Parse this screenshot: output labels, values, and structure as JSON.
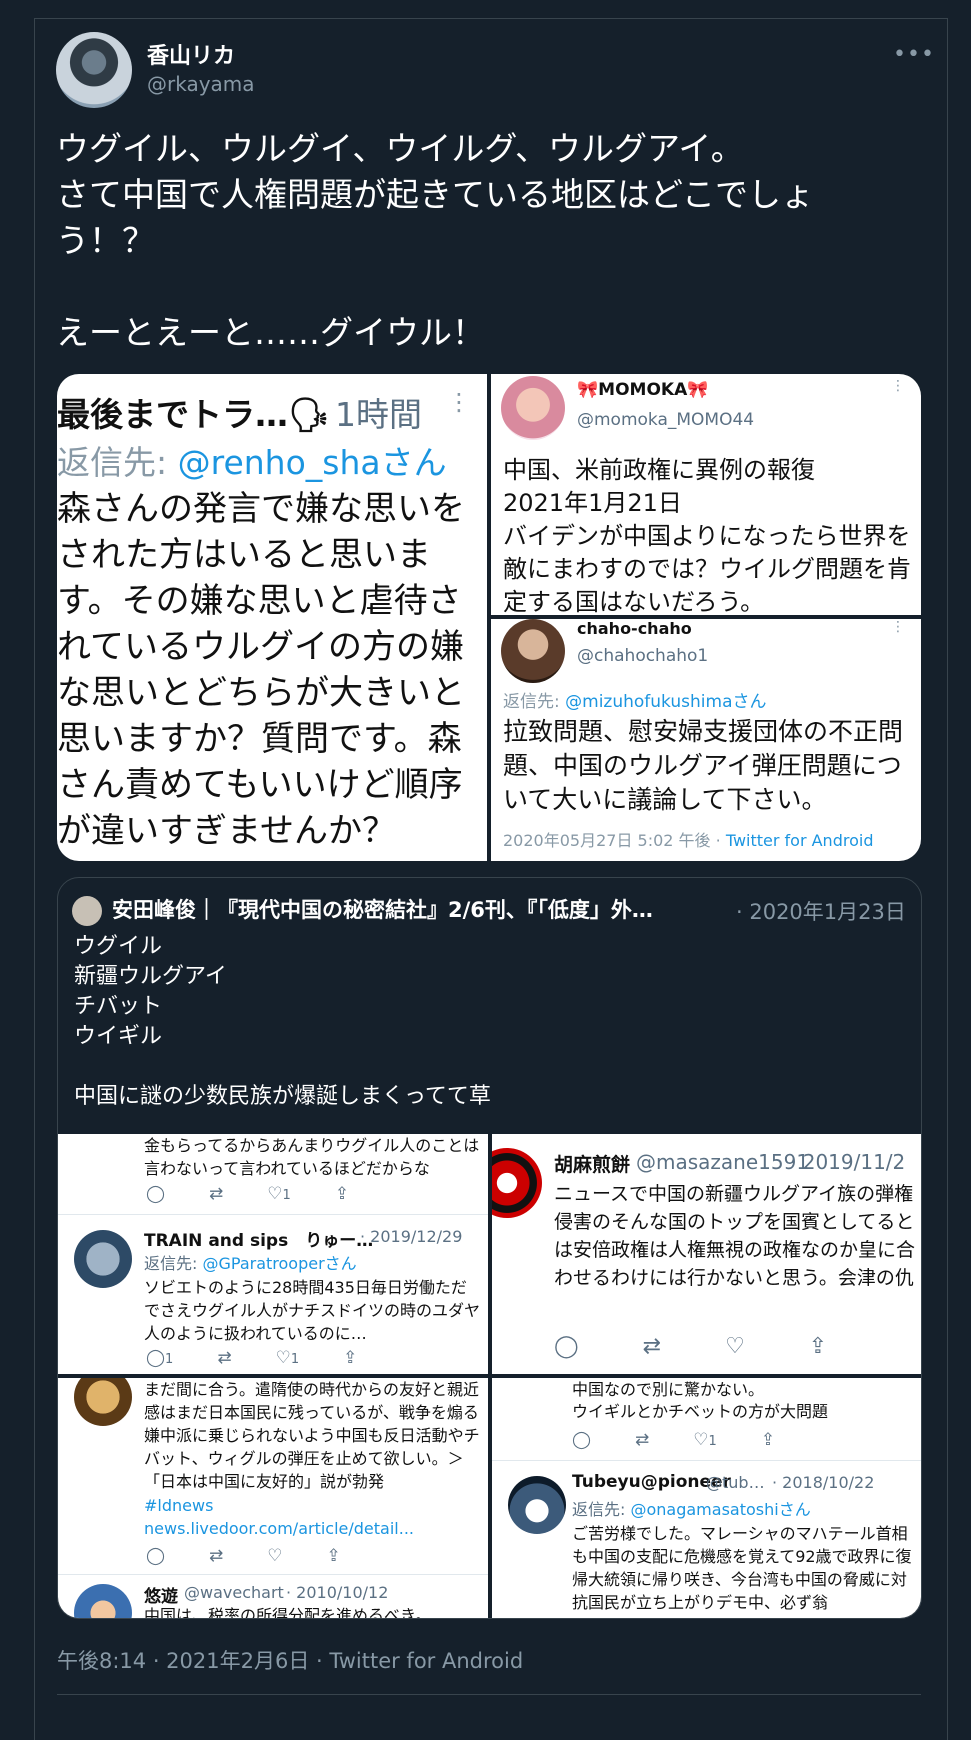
{
  "tweet": {
    "display_name": "香山リカ",
    "handle": "@rkayama",
    "more_icon": "more-horizontal-icon",
    "text": "ウグイル、ウルグイ、ウイルグ、ウルグアイ。\nさて中国で人権問題が起きている地区はどこでしょ\nう！？\n\nえーとえーと……グイウル！",
    "timestamp": "午後8:14 · 2021年2月6日 · Twitter for Android"
  },
  "images": {
    "a": {
      "header": "最後までトラ…🗣",
      "time": "1時間",
      "reply_prefix": "返信先: ",
      "reply_to": "@renho_shaさん",
      "text": "森さんの発言で嫌な思いをされた方はいると思います。その嫌な思いと虐待されているウルグイの方の嫌な思いとどちらが大きいと思いますか？質問です。森さん責めてもいいけど順序が違いすぎませんか？"
    },
    "b": {
      "name": "🎀MOMOKA🎀",
      "handle": "@momoka_MOMO44",
      "text": "中国、米前政権に異例の報復\n2021年1月21日\nバイデンが中国よりになったら世界を敵にまわすのでは？ウイルグ問題を肯定する国はないだろう。"
    },
    "c": {
      "name": "chaho-chaho",
      "handle": "@chahochaho1",
      "reply_prefix": "返信先: ",
      "reply_to": "@mizuhofukushimaさん",
      "text": "拉致問題、慰安婦支援団体の不正問題、中国のウルグアイ弾圧問題について大いに議論して下さい。",
      "meta_date": "2020年05月27日 5:02 午後 · ",
      "meta_client": "Twitter for Android"
    }
  },
  "quote": {
    "name": "安田峰俊｜『現代中国の秘密結社』2/6刊、『「低度」外…",
    "date": "· 2020年1月23日",
    "text": "ウグイル\n新疆ウルグアイ\nチバット\nウイギル\n\n中国に謎の少数民族が爆誕しまくってて草",
    "q1": {
      "text_top": "金もらってるからあんまりウグイル人のことは言わないって言われているほどだからな",
      "likes_top": "1",
      "name": "TRAIN and sips　りゅー…",
      "date": "· 2019/12/29",
      "reply_prefix": "返信先: ",
      "reply_to": "@GParatrooperさん",
      "text": "ソビエトのように28時間435日毎日労働ただでさえウグイル人がナチスドイツの時のユダヤ人のように扱われているのに…",
      "replies": "1",
      "likes": "1"
    },
    "q2": {
      "name": "胡麻煎餅",
      "handle": "@masazane1591",
      "date": "· 2019/11/2",
      "text": "ニュースで中国の新疆ウルグアイ族の弾権侵害のそんな国のトップを国賓としてるとは安倍政権は人権無視の政権なのか皇に合わせるわけには行かないと思う。会津の仇"
    },
    "q3": {
      "text": "まだ間に合う。遣隋使の時代からの友好と親近感はまだ日本国民に残っているが、戦争を煽る嫌中派に乗じられないよう中国も反日活動やチバット、ウィグルの弾圧を止めて欲しい。＞「日本は中国に友好的」説が勃発",
      "link": "#ldnews news.livedoor.com/article/detail...",
      "name2": "悠遊",
      "handle2": "@wavechart",
      "date2": "· 2010/10/12",
      "text2": "中国は、税率の所得分配を進めるべき。"
    },
    "q4": {
      "text_top1": "中国なので別に驚かない。",
      "text_top2": "ウイギルとかチベットの方が大問題",
      "likes_top": "1",
      "name": "Tubeyu@pioneer",
      "handle": "@tub…",
      "date": "· 2018/10/22",
      "reply_prefix": "返信先: ",
      "reply_to": "@onagamasatoshiさん",
      "text": "ご苦労様でした。マレーシャのマハテール首相も中国の支配に危機感を覚えて92歳で政界に復帰大統領に帰り咲き、今台湾も中国の脅威に対抗国民が立ち上がりデモ中、必ず翁"
    }
  },
  "colors": {
    "background": "#15202b",
    "border": "#38444d",
    "secondary_text": "#8899a6",
    "link": "#1b95e0"
  }
}
